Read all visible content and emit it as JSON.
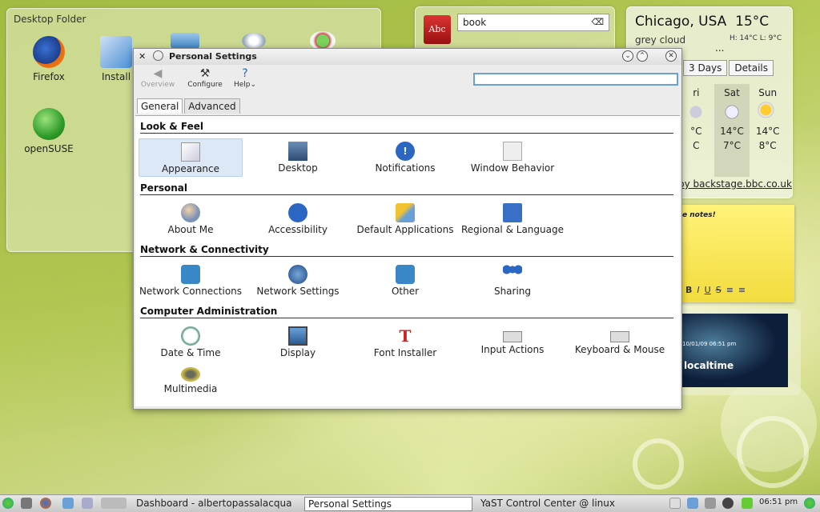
{
  "desktop_folder": {
    "title": "Desktop Folder",
    "icons": [
      {
        "label": "Firefox",
        "icon": "firefox-icon"
      },
      {
        "label": "Install",
        "icon": "install-icon"
      },
      {
        "label": "",
        "icon": "screen-icon"
      },
      {
        "label": "",
        "icon": "openoffice-icon"
      },
      {
        "label": "",
        "icon": "clock-icon"
      },
      {
        "label": "openSUSE",
        "icon": "opensuse-icon"
      }
    ]
  },
  "dictionary": {
    "book_label": "Abc",
    "query": "book"
  },
  "weather": {
    "city": "Chicago, USA",
    "temp": "15°C",
    "condition": "grey cloud",
    "hilo": "H: 14°C  L: 9°C",
    "ellipsis": "...",
    "tabs": [
      "3 Days",
      "Details"
    ],
    "days": [
      {
        "name": "ri",
        "high": "°C",
        "low": "C"
      },
      {
        "name": "Sat",
        "high": "14°C",
        "low": "7°C"
      },
      {
        "name": "Sun",
        "high": "14°C",
        "low": "8°C"
      }
    ],
    "source": "by backstage.bbc.co.uk"
  },
  "note": {
    "text": "e notes!",
    "tools": [
      "B",
      "I",
      "U",
      "S",
      "≡",
      "≡"
    ]
  },
  "world_clock": {
    "time": "10/01/09 06:51 pm",
    "location": "localtime"
  },
  "window": {
    "title": "Personal Settings",
    "toolbar": {
      "overview": "Overview",
      "configure": "Configure",
      "help": "Help"
    },
    "search_value": "",
    "tabs": [
      "General",
      "Advanced"
    ],
    "sections": [
      {
        "title": "Look & Feel",
        "items": [
          "Appearance",
          "Desktop",
          "Notifications",
          "Window Behavior"
        ]
      },
      {
        "title": "Personal",
        "items": [
          "About Me",
          "Accessibility",
          "Default Applications",
          "Regional & Language"
        ]
      },
      {
        "title": "Network & Connectivity",
        "items": [
          "Network Connections",
          "Network Settings",
          "Other",
          "Sharing"
        ]
      },
      {
        "title": "Computer Administration",
        "items": [
          "Date & Time",
          "Display",
          "Font Installer",
          "Input Actions",
          "Keyboard & Mouse",
          "Multimedia"
        ]
      }
    ]
  },
  "taskbar": {
    "tasks": [
      "Dashboard - albertopassalacqua",
      "Personal Settings",
      "YaST Control Center @ linux"
    ],
    "clock": "06:51 pm"
  },
  "colors": {
    "selection": "#dce8f6",
    "accent": "#6a9fd8",
    "note": "#f3dc3e"
  }
}
